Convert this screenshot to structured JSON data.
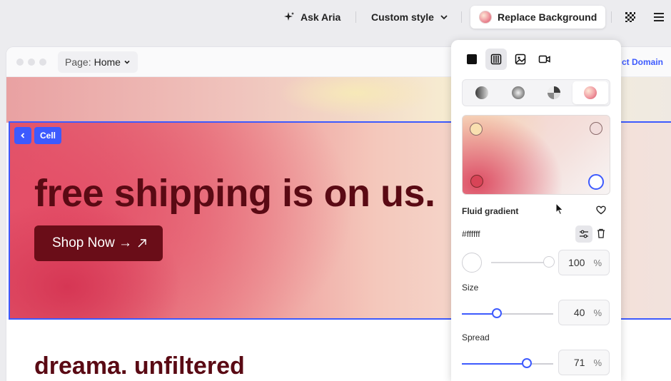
{
  "toolbar": {
    "ask_aria": "Ask Aria",
    "custom_style": "Custom style",
    "replace_background": "Replace Background"
  },
  "window": {
    "page_prefix": "Page:",
    "page_name": "Home",
    "connect_domain": "ct Domain"
  },
  "canvas": {
    "cell_tag": "Cell",
    "headline": "free shipping is on us.",
    "shop_button": "Shop Now →",
    "subhead": "dreama. unfiltered"
  },
  "panel": {
    "gradient_name": "Fluid gradient",
    "hex": "#ffffff",
    "opacity": {
      "value": "100",
      "unit": "%",
      "fraction": 1.0
    },
    "size": {
      "label": "Size",
      "value": "40",
      "unit": "%",
      "fraction": 0.38
    },
    "spread": {
      "label": "Spread",
      "value": "71",
      "unit": "%",
      "fraction": 0.71
    }
  },
  "colors": {
    "accent": "#3d5afe",
    "brand_dark": "#6a0d18",
    "headline": "#5a0a14"
  }
}
